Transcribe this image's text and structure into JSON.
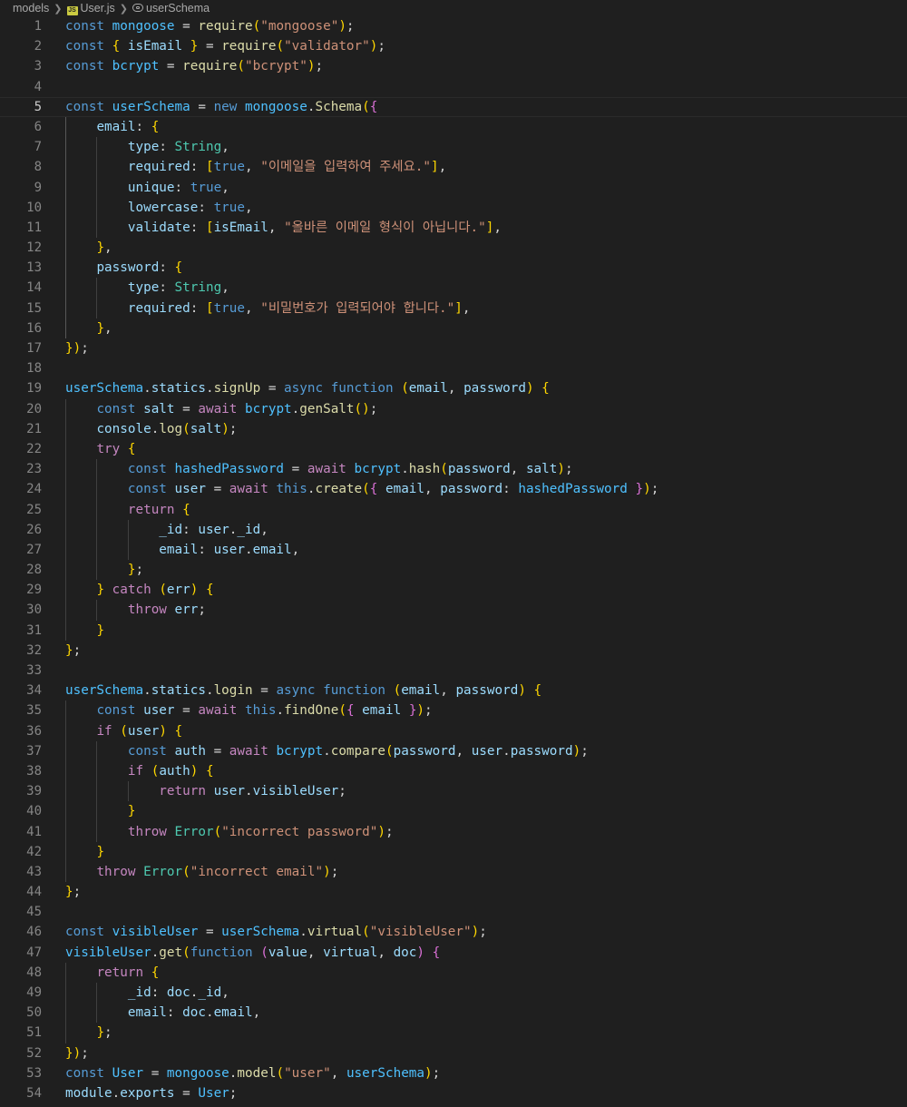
{
  "breadcrumb": {
    "folder": "models",
    "file": "User.js",
    "file_icon_text": "JS",
    "symbol": "userSchema"
  },
  "editor": {
    "current_line": 5,
    "lines": [
      "const mongoose = require(\"mongoose\");",
      "const { isEmail } = require(\"validator\");",
      "const bcrypt = require(\"bcrypt\");",
      "",
      "const userSchema = new mongoose.Schema({",
      "    email: {",
      "        type: String,",
      "        required: [true, \"이메일을 입력하여 주세요.\"],",
      "        unique: true,",
      "        lowercase: true,",
      "        validate: [isEmail, \"올바른 이메일 형식이 아닙니다.\"],",
      "    },",
      "    password: {",
      "        type: String,",
      "        required: [true, \"비밀번호가 입력되어야 합니다.\"],",
      "    },",
      "});",
      "",
      "userSchema.statics.signUp = async function (email, password) {",
      "    const salt = await bcrypt.genSalt();",
      "    console.log(salt);",
      "    try {",
      "        const hashedPassword = await bcrypt.hash(password, salt);",
      "        const user = await this.create({ email, password: hashedPassword });",
      "        return {",
      "            _id: user._id,",
      "            email: user.email,",
      "        };",
      "    } catch (err) {",
      "        throw err;",
      "    }",
      "};",
      "",
      "userSchema.statics.login = async function (email, password) {",
      "    const user = await this.findOne({ email });",
      "    if (user) {",
      "        const auth = await bcrypt.compare(password, user.password);",
      "        if (auth) {",
      "            return user.visibleUser;",
      "        }",
      "        throw Error(\"incorrect password\");",
      "    }",
      "    throw Error(\"incorrect email\");",
      "};",
      "",
      "const visibleUser = userSchema.virtual(\"visibleUser\");",
      "visibleUser.get(function (value, virtual, doc) {",
      "    return {",
      "        _id: doc._id,",
      "        email: doc.email,",
      "    };",
      "});",
      "const User = mongoose.model(\"user\", userSchema);",
      "module.exports = User;"
    ]
  }
}
